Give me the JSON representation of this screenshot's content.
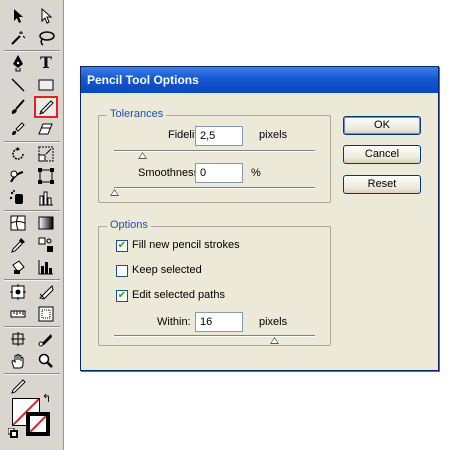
{
  "toolbox": {
    "selected_tool": "pencil-tool",
    "tools": [
      [
        "selection-icon",
        "direct-selection-icon"
      ],
      [
        "magic-wand-icon",
        "lasso-icon"
      ],
      [
        "pen-icon",
        "type-icon"
      ],
      [
        "line-segment-icon",
        "rectangle-icon"
      ],
      [
        "paintbrush-icon",
        "pencil-icon"
      ],
      [
        "blob-brush-icon",
        "eraser-icon"
      ],
      [
        "rotate-icon",
        "scale-icon"
      ],
      [
        "warp-icon",
        "free-transform-icon"
      ],
      [
        "symbol-sprayer-icon",
        "column-graph-icon"
      ],
      [
        "mesh-icon",
        "gradient-icon"
      ],
      [
        "eyedropper-icon",
        "blend-icon"
      ],
      [
        "live-paint-bucket-icon",
        "bar-graph-icon"
      ],
      [
        "crop-area-icon",
        "slice-icon"
      ],
      [
        "measure-icon",
        "artboard-icon"
      ],
      [
        "scissors-icon",
        "knife-icon"
      ],
      [
        "hand-icon",
        "zoom-icon"
      ],
      [
        "pencil-small-icon",
        ""
      ]
    ],
    "glyphs": {
      "type": "T",
      "swap": "↰"
    }
  },
  "dialog": {
    "title": "Pencil Tool Options",
    "tolerances": {
      "title": "Tolerances",
      "fidelity_label": "Fidelity:",
      "fidelity_value": "2,5",
      "fidelity_unit": "pixels",
      "fidelity_level": 0.14,
      "smoothness_label": "Smoothness:",
      "smoothness_value": "0",
      "smoothness_unit": "%",
      "smoothness_level": 0.0
    },
    "options": {
      "title": "Options",
      "fill_label": "Fill new pencil strokes",
      "fill_checked": true,
      "keep_label": "Keep selected",
      "keep_checked": false,
      "edit_label": "Edit selected paths",
      "edit_checked": true,
      "within_label": "Within:",
      "within_value": "16",
      "within_unit": "pixels",
      "within_level": 0.8
    },
    "buttons": {
      "ok": "OK",
      "cancel": "Cancel",
      "reset": "Reset"
    },
    "check_mark": "✔"
  },
  "colors": {
    "title_bar": "#1458d2",
    "group_title": "#1f4fb3",
    "selected_tool_outline": "#e41f25",
    "check": "#21a121"
  }
}
